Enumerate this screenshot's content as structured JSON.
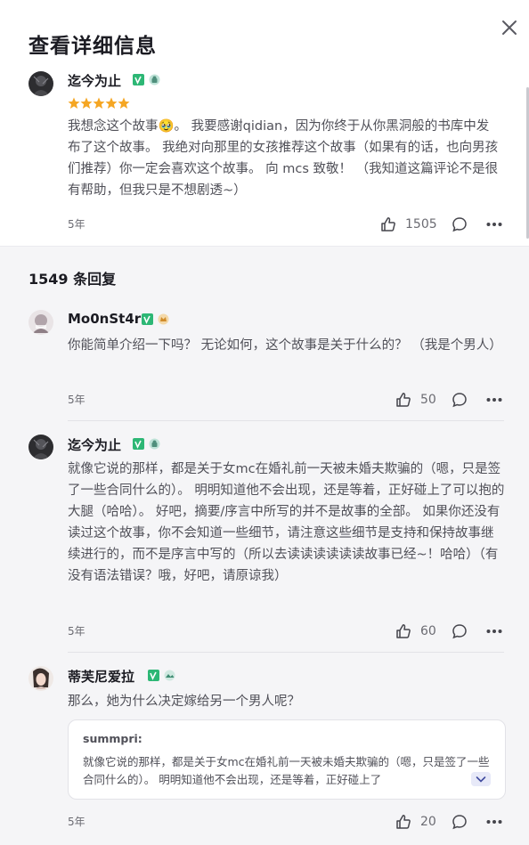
{
  "header": {
    "title": "查看详细信息"
  },
  "main_review": {
    "username": "迄今为止",
    "rating": 5,
    "text": "我想念这个故事🥹。 我要感谢qidian，因为你终于从你黑洞般的书库中发布了这个故事。 我绝对向那里的女孩推荐这个故事（如果有的话，也向男孩们推荐）你一定会喜欢这个故事。 向 mcs 致敬！ （我知道这篇评论不是很有帮助，但我只是不想剧透~）",
    "time": "5年",
    "likes": "1505"
  },
  "replies_header": "1549 条回复",
  "replies": [
    {
      "username": "Mo0nSt4r",
      "text": "你能简单介绍一下吗？ 无论如何，这个故事是关于什么的？ （我是个男人）",
      "time": "5年",
      "likes": "50"
    },
    {
      "username": "迄今为止",
      "text": "就像它说的那样，都是关于女mc在婚礼前一天被未婚夫欺骗的（嗯，只是签了一些合同什么的）。 明明知道他不会出现，还是等着，正好碰上了可以抱的大腿（哈哈）。 好吧，摘要/序言中所写的并不是故事的全部。 如果你还没有读过这个故事，你不会知道一些细节，请注意这些细节是支持和保持故事继续进行的，而不是序言中写的（所以去读读读读读读故事已经~！哈哈）（有没有语法错误？哦，好吧，请原谅我）",
      "time": "5年",
      "likes": "60"
    },
    {
      "username": "蒂芙尼爱拉",
      "text": "那么，她为什么决定嫁给另一个男人呢？",
      "quote_author": "summpri:",
      "quote_text": "就像它说的那样，都是关于女mc在婚礼前一天被未婚夫欺骗的（嗯，只是签了一些合同什么的）。 明明知道他不会出现，还是等着，正好碰上了",
      "time": "5年",
      "likes": "20"
    }
  ],
  "icons": {
    "close": "close-icon",
    "like": "thumbs-up-icon",
    "comment": "comment-bubble-icon",
    "more": "more-dots-icon",
    "verified": "verified-badge-icon",
    "level": "level-badge-icon"
  },
  "colors": {
    "accent": "#4a7cf0",
    "star": "#f5a623",
    "badge_green": "#2db775"
  }
}
